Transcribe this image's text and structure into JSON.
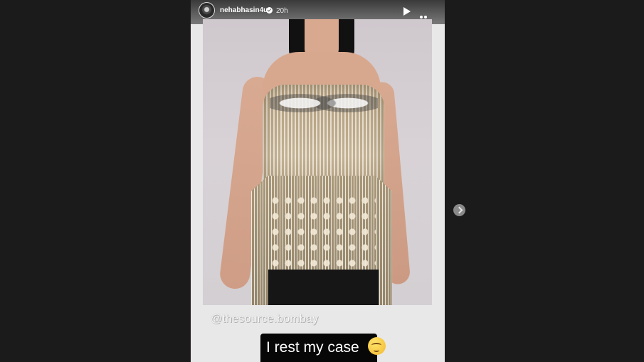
{
  "header": {
    "username": "nehabhasin4u",
    "timestamp": "20h",
    "icons": [
      "avatar",
      "verified-badge-icon",
      "play-icon",
      "more-options-icon"
    ]
  },
  "story": {
    "mention": "@thesource.bombay",
    "caption": "I rest my case",
    "emoji": "relieved-face-icon",
    "image_description_icon": "story-photo"
  },
  "navigation": {
    "next_icon": "chevron-right-icon"
  },
  "colors": {
    "background": "#1b1b1b",
    "story_background": "#e9e8e8",
    "caption_background": "#070707",
    "text": "#ffffff"
  }
}
